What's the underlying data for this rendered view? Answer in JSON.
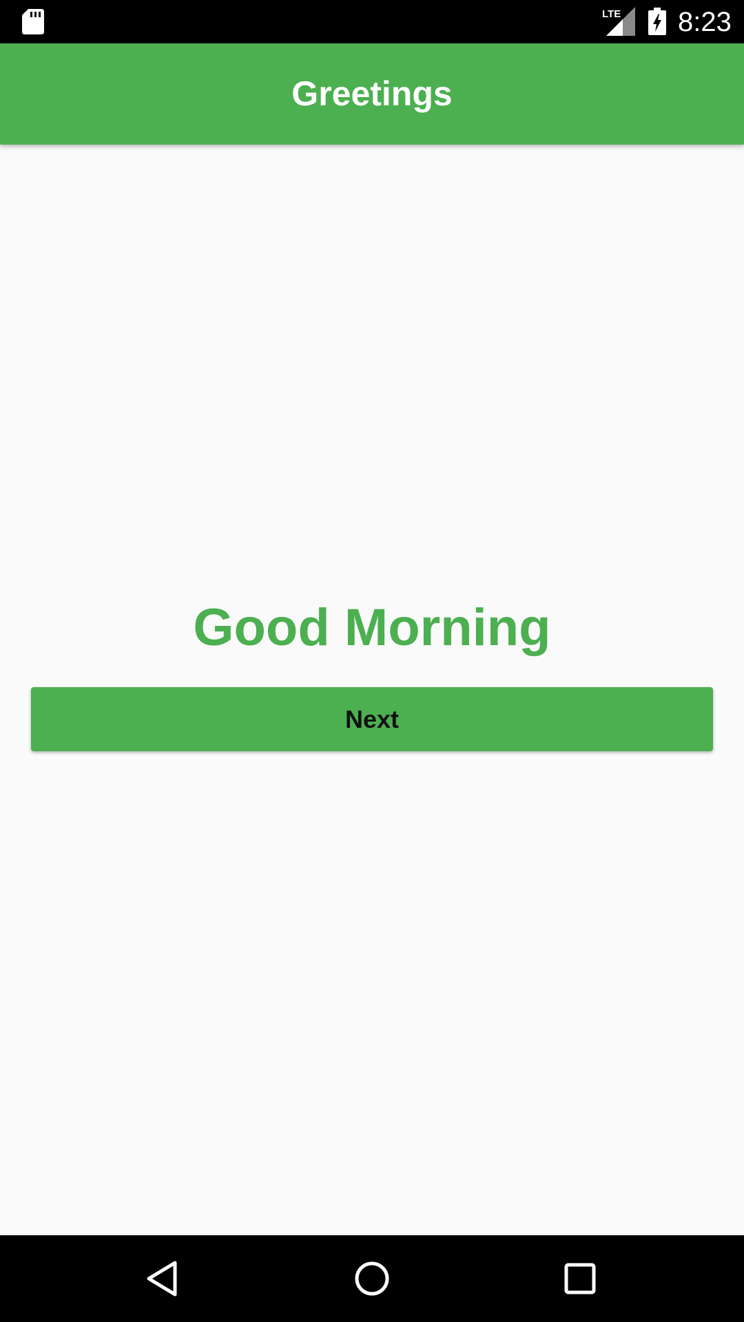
{
  "status_bar": {
    "time": "8:23",
    "network_label": "LTE",
    "icons": [
      "sd-card-icon",
      "lte-signal-icon",
      "battery-charging-icon"
    ]
  },
  "app_bar": {
    "title": "Greetings"
  },
  "main": {
    "greeting": "Good Morning",
    "next_button_label": "Next"
  },
  "nav_bar": {
    "icons": [
      "back-icon",
      "home-icon",
      "recents-icon"
    ]
  },
  "colors": {
    "primary": "#4caf50",
    "background": "#fafafa",
    "system_bar": "#000000",
    "button_text": "#111111"
  }
}
